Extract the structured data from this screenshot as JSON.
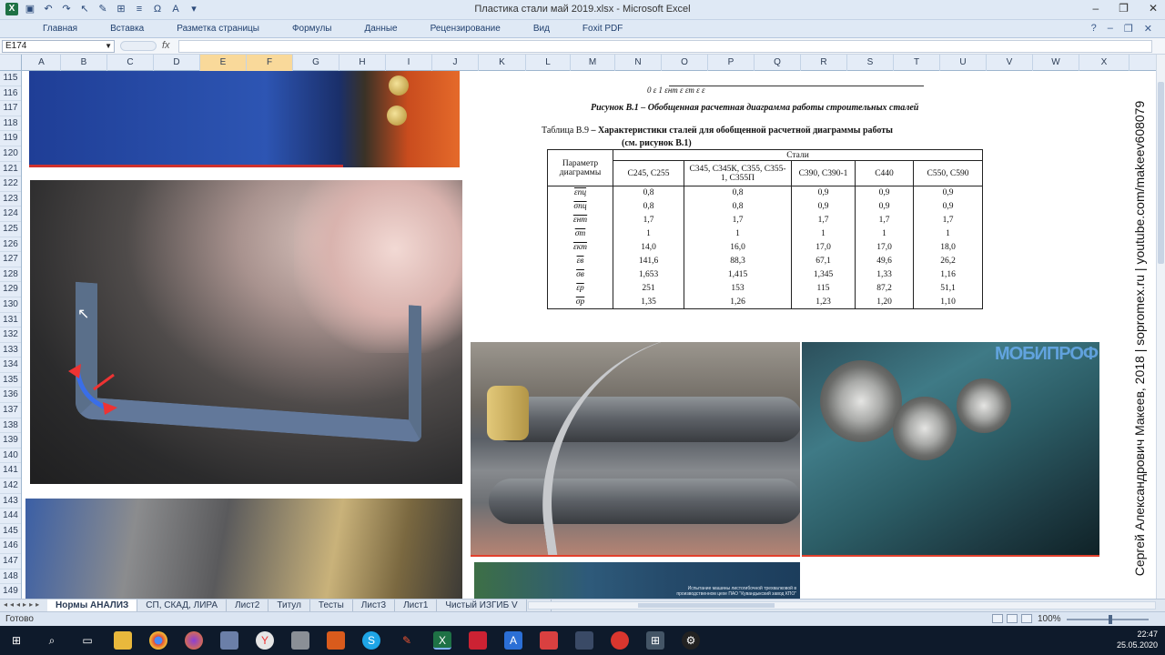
{
  "window": {
    "title": "Пластика стали май 2019.xlsx - Microsoft Excel",
    "logo_text": "X",
    "controls": [
      "–",
      "❐",
      "✕"
    ]
  },
  "ribbon": {
    "tabs": [
      "Главная",
      "Вставка",
      "Разметка страницы",
      "Формулы",
      "Данные",
      "Рецензирование",
      "Вид",
      "Foxit PDF"
    ]
  },
  "formula_bar": {
    "name_box": "E174",
    "fx": "fx",
    "value": ""
  },
  "columns": [
    "A",
    "B",
    "C",
    "D",
    "E",
    "F",
    "G",
    "H",
    "I",
    "J",
    "K",
    "L",
    "M",
    "N",
    "O",
    "P",
    "Q",
    "R",
    "S",
    "T",
    "U",
    "V",
    "W",
    "X"
  ],
  "selected_columns": [
    "E",
    "F"
  ],
  "rows": [
    "115",
    "116",
    "117",
    "118",
    "119",
    "120",
    "121",
    "122",
    "123",
    "124",
    "125",
    "126",
    "127",
    "128",
    "129",
    "130",
    "131",
    "132",
    "133",
    "134",
    "135",
    "136",
    "137",
    "138",
    "139",
    "140",
    "141",
    "142",
    "143",
    "144",
    "145",
    "146",
    "147",
    "148",
    "149"
  ],
  "document": {
    "axis_labels": "0    ε     1     εнт          ε          εт            ε   ε",
    "figure_caption_label": "Рисунок В.1",
    "figure_caption_text": " – Обобщенная расчетная диаграмма работы строительных сталей",
    "table_caption_label": "Таблица В.9",
    "table_caption_text": " – Характеристики сталей для обобщенной расчетной диаграммы работы",
    "table_caption_2": "(см. рисунок В.1)",
    "table": {
      "param_header": "Параметр диаграммы",
      "group_header": "Стали",
      "columns": [
        "С245, С255",
        "С345, С345К, С355, С355-1, С355П",
        "С390, С390-1",
        "С440",
        "С550, С590"
      ],
      "rows": [
        {
          "param": "εпц",
          "values": [
            "0,8",
            "0,8",
            "0,9",
            "0,9",
            "0,9"
          ]
        },
        {
          "param": "σпц",
          "values": [
            "0,8",
            "0,8",
            "0,9",
            "0,9",
            "0,9"
          ]
        },
        {
          "param": "εнт",
          "values": [
            "1,7",
            "1,7",
            "1,7",
            "1,7",
            "1,7"
          ]
        },
        {
          "param": "σт",
          "values": [
            "1",
            "1",
            "1",
            "1",
            "1"
          ]
        },
        {
          "param": "εкт",
          "values": [
            "14,0",
            "16,0",
            "17,0",
            "17,0",
            "18,0"
          ]
        },
        {
          "param": "εв",
          "values": [
            "141,6",
            "88,3",
            "67,1",
            "49,6",
            "26,2"
          ]
        },
        {
          "param": "σв",
          "values": [
            "1,653",
            "1,415",
            "1,345",
            "1,33",
            "1,16"
          ]
        },
        {
          "param": "εр",
          "values": [
            "251",
            "153",
            "115",
            "87,2",
            "51,1"
          ]
        },
        {
          "param": "σр",
          "values": [
            "1,35",
            "1,26",
            "1,23",
            "1,20",
            "1,10"
          ]
        }
      ]
    }
  },
  "images": {
    "logo_overlay": "МОБИПРОФ",
    "caption_overlay": "Испытание машины листогибочной трехвалковой в производственном цехе ПАО \"Кувандыкский завод КПО\""
  },
  "watermark": "Сергей Александрович Макеев, 2018 | sopromex.ru | youtube.com/makeev608079",
  "sheets": [
    "Нормы АНАЛИЗ",
    "СП, СКАД, ЛИРА",
    "Лист2",
    "Титул",
    "Тесты",
    "Лист3",
    "Лист1",
    "Чистый ИЗГИБ V"
  ],
  "active_sheet": "Нормы АНАЛИЗ",
  "status": {
    "ready": "Готово",
    "zoom": "100%"
  },
  "taskbar": {
    "time": "22:47",
    "date": "25.05.2020"
  },
  "colors": {
    "ribbon_bg": "#dfe9f5",
    "header_bg": "#e4ecf7",
    "selected_col": "#f9d99a",
    "taskbar": "#0e1a2b"
  }
}
